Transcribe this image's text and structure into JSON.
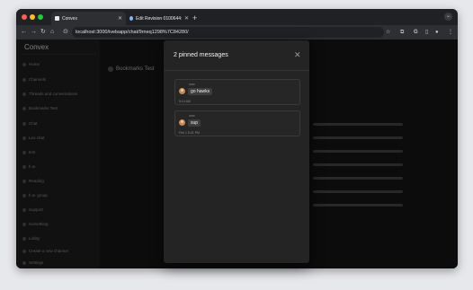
{
  "browser": {
    "tabs": [
      {
        "title": "Convex",
        "active": true
      },
      {
        "title": "Edit Revision 0100644: — —",
        "active": false
      }
    ],
    "new_tab": "+",
    "address": "localhost:3000/ivelsapp/chat/9rneq1298%7C84280/",
    "colors": {
      "close": "#ff5f57",
      "minimize": "#febc2e",
      "zoom": "#28c840"
    }
  },
  "app": {
    "brand": "Convex",
    "sidebar_items": [
      {
        "label": "Home",
        "count": ""
      },
      {
        "label": "Channels",
        "count": ""
      },
      {
        "label": "Threads and conversations",
        "count": ""
      },
      {
        "label": "Bookmarks Test",
        "count": ""
      },
      {
        "label": "Chat",
        "count": ""
      },
      {
        "label": "Leo chat",
        "count": ""
      },
      {
        "label": "test",
        "count": ""
      },
      {
        "label": "h.w.",
        "count": ""
      },
      {
        "label": "Reading",
        "count": ""
      },
      {
        "label": "h.w. group",
        "count": ""
      },
      {
        "label": "Support",
        "count": ""
      },
      {
        "label": "Something",
        "count": ""
      },
      {
        "label": "Lobby",
        "count": ""
      },
      {
        "label": "Create a new channel",
        "count": ""
      },
      {
        "label": "Settings",
        "count": ""
      }
    ],
    "channel_title": "Bookmarks Test"
  },
  "modal": {
    "title": "2 pinned messages",
    "messages": [
      {
        "author": "user",
        "text": "go hawks",
        "time": "5:14 AM"
      },
      {
        "author": "user",
        "text": "sup",
        "time": "Feb 1 5:01 PM"
      }
    ]
  }
}
